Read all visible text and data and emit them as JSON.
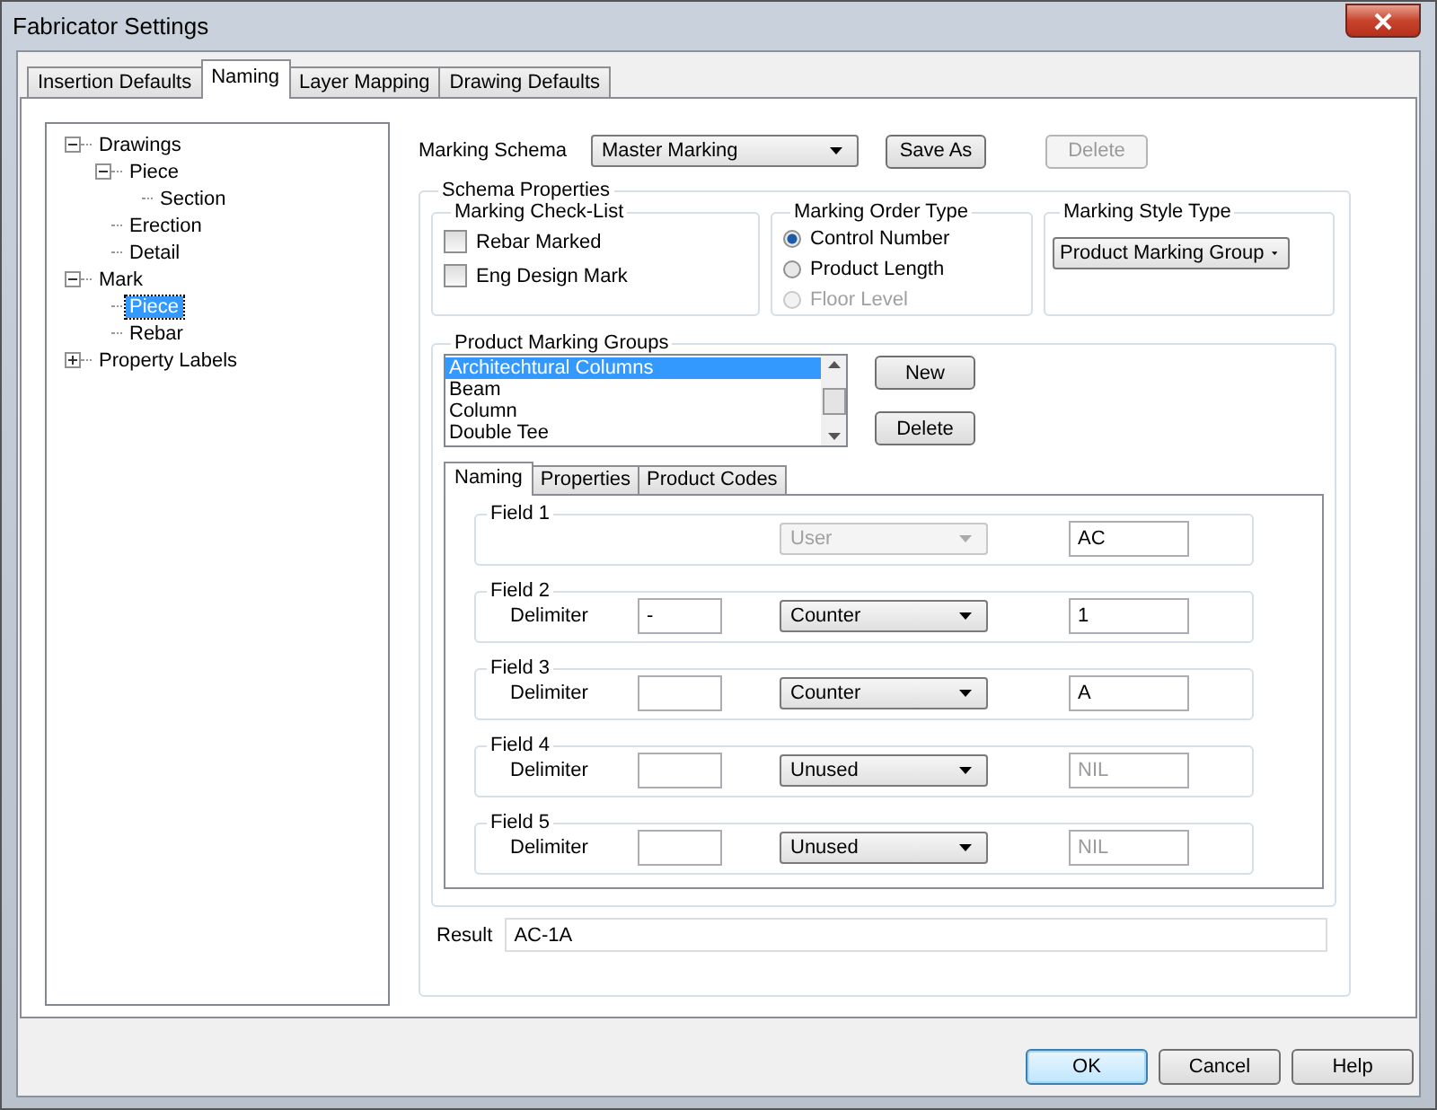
{
  "window": {
    "title": "Fabricator Settings"
  },
  "tabs": [
    {
      "label": "Insertion Defaults",
      "selected": false
    },
    {
      "label": "Naming",
      "selected": true
    },
    {
      "label": "Layer Mapping",
      "selected": false
    },
    {
      "label": "Drawing Defaults",
      "selected": false
    }
  ],
  "tree": [
    {
      "label": "Drawings",
      "expanded": true,
      "selected": false,
      "children": [
        {
          "label": "Piece",
          "expanded": true,
          "selected": false,
          "children": [
            {
              "label": "Section",
              "selected": false
            }
          ]
        },
        {
          "label": "Erection",
          "selected": false
        },
        {
          "label": "Detail",
          "selected": false
        }
      ]
    },
    {
      "label": "Mark",
      "expanded": true,
      "selected": false,
      "children": [
        {
          "label": "Piece",
          "selected": true
        },
        {
          "label": "Rebar",
          "selected": false
        }
      ]
    },
    {
      "label": "Property Labels",
      "expanded": false,
      "selected": false
    }
  ],
  "marking_schema": {
    "label": "Marking Schema",
    "value": "Master Marking",
    "buttons": [
      {
        "label": "Save As",
        "disabled": false
      },
      {
        "label": "Delete",
        "disabled": true
      }
    ]
  },
  "schema_properties": {
    "title": "Schema Properties",
    "check_list": {
      "title": "Marking Check-List",
      "items": [
        {
          "label": "Rebar Marked",
          "checked": false
        },
        {
          "label": "Eng Design Mark",
          "checked": false
        }
      ]
    },
    "order_type": {
      "title": "Marking Order Type",
      "options": [
        {
          "label": "Control Number",
          "selected": true,
          "disabled": false
        },
        {
          "label": "Product Length",
          "selected": false,
          "disabled": false
        },
        {
          "label": "Floor Level",
          "selected": false,
          "disabled": true
        }
      ]
    },
    "style_type": {
      "title": "Marking Style Type",
      "value": "Product Marking Group"
    }
  },
  "groups": {
    "title": "Product Marking Groups",
    "items": [
      {
        "label": "Architechtural Columns",
        "selected": true
      },
      {
        "label": "Beam",
        "selected": false
      },
      {
        "label": "Column",
        "selected": false
      },
      {
        "label": "Double Tee",
        "selected": false
      }
    ],
    "buttons": [
      "New",
      "Delete"
    ]
  },
  "inner_tabs": [
    {
      "label": "Naming",
      "selected": true
    },
    {
      "label": "Properties",
      "selected": false
    },
    {
      "label": "Product Codes",
      "selected": false
    }
  ],
  "fields": [
    {
      "title": "Field 1",
      "type": {
        "value": "User",
        "disabled": true
      },
      "result": {
        "value": "AC",
        "disabled": false
      }
    },
    {
      "title": "Field 2",
      "delimiter": {
        "label": "Delimiter",
        "value": "-"
      },
      "type": {
        "value": "Counter",
        "disabled": false
      },
      "result": {
        "value": "1",
        "disabled": false
      }
    },
    {
      "title": "Field 3",
      "delimiter": {
        "label": "Delimiter"
      },
      "type": {
        "value": "Counter",
        "disabled": false
      },
      "result": {
        "value": "A",
        "disabled": false
      }
    },
    {
      "title": "Field 4",
      "delimiter": {
        "label": "Delimiter"
      },
      "type": {
        "value": "Unused",
        "disabled": false
      },
      "result": {
        "value": "NIL",
        "disabled": true
      }
    },
    {
      "title": "Field 5",
      "delimiter": {
        "label": "Delimiter"
      },
      "type": {
        "value": "Unused",
        "disabled": false
      },
      "result": {
        "value": "NIL",
        "disabled": true
      }
    }
  ],
  "result": {
    "label": "Result",
    "value": "AC-1A"
  },
  "buttons": [
    {
      "label": "OK",
      "default": true
    },
    {
      "label": "Cancel",
      "default": false
    },
    {
      "label": "Help",
      "default": false
    }
  ]
}
